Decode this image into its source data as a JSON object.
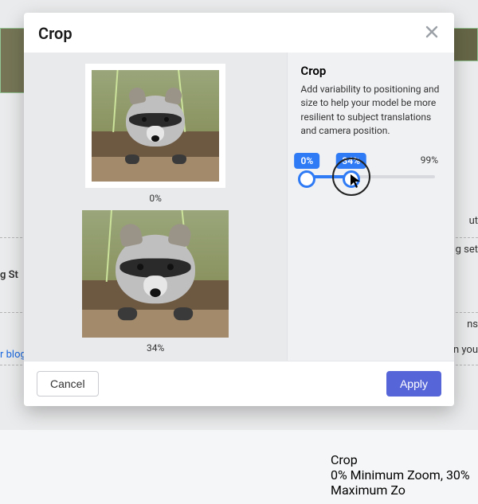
{
  "modal": {
    "title": "Crop",
    "section_title": "Crop",
    "description": "Add variability to positioning and size to help your model be more resilient to subject translations and camera position.",
    "previews": [
      {
        "caption": "0%"
      },
      {
        "caption": "34%"
      }
    ],
    "slider": {
      "min_label": "0%",
      "value_label": "34%",
      "max_label": "99%",
      "min_pct": 0,
      "value_pct": 34,
      "range_max_pct": 99
    },
    "footer": {
      "cancel": "Cancel",
      "apply": "Apply"
    }
  },
  "background": {
    "blog_link": "r blog.",
    "section_frag": "g St",
    "ut_frag": "ut",
    "set_frag": "g set",
    "ns_frag": "ns",
    "nyou_frag": "n you",
    "card_title": "Crop",
    "card_sub": "0% Minimum Zoom, 30% Maximum Zo"
  }
}
